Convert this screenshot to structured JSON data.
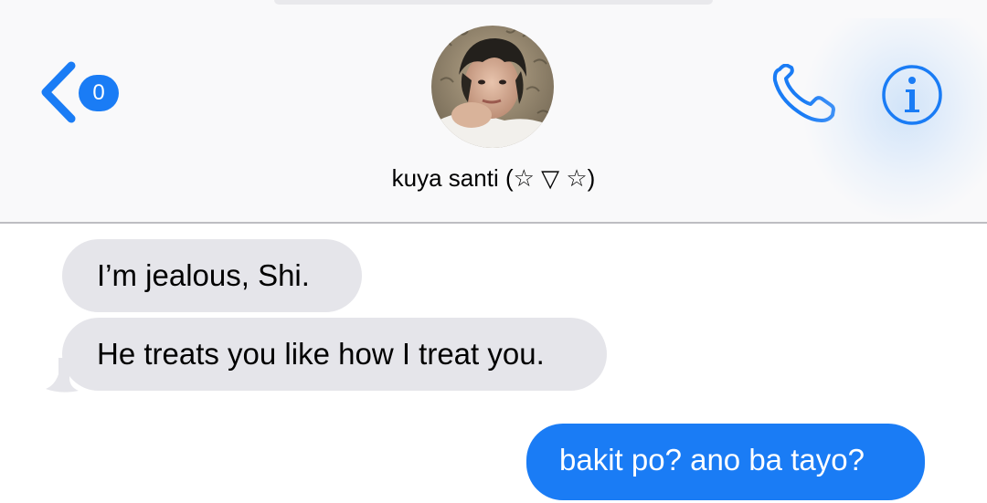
{
  "header": {
    "back_badge_count": "0",
    "contact_name": "kuya santi (☆ ▽ ☆)",
    "accent_color": "#1a7cf5"
  },
  "icons": {
    "back": "chevron-left-icon",
    "call": "phone-icon",
    "info": "info-icon",
    "avatar": "contact-photo"
  },
  "messages": [
    {
      "direction": "incoming",
      "text": "I’m jealous, Shi."
    },
    {
      "direction": "incoming",
      "text": "He treats you like how I treat you."
    },
    {
      "direction": "outgoing",
      "text": "bakit po? ano ba tayo?"
    }
  ],
  "colors": {
    "incoming_bubble": "#e5e5ea",
    "outgoing_bubble": "#1a7cf5",
    "header_background": "#f9f9fa"
  }
}
